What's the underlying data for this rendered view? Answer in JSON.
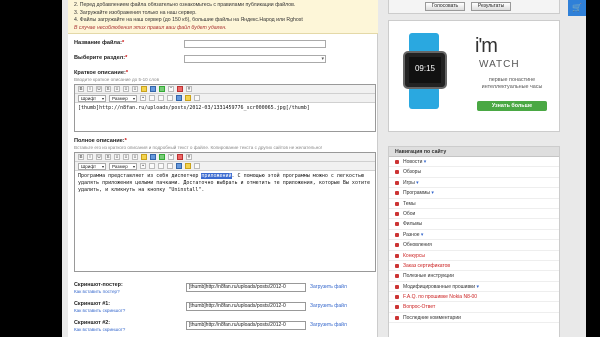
{
  "notice": {
    "line1": "2. Перед добавлением файла обязательно ознакомьтесь с правилами публикации файлов.",
    "line2": "3. Загружайте изображения только на наш сервер.",
    "line3": "4. Файлы загружайте на наш сервер (до 150 кб), большие файлы на Яндекс.Народ или Rghost",
    "line4": "В случае несоблюдения этих правил ваш файл будет удален."
  },
  "form": {
    "file_name_label": "Название файла:",
    "section_label": "Выберите раздел:",
    "short_desc_label": "Краткое описание:",
    "short_desc_hint": "Вводите краткое описание до 5-10 слов",
    "full_desc_label": "Полное описание:",
    "full_desc_hint": "Вставьте его из краткого описания и подробный текст о файле. Копирование текста с других сайтов не желательно!",
    "required_mark": "*"
  },
  "editor": {
    "font_label": "Шрифт",
    "size_label": "Размер",
    "short_text": "[thumb]http://n8fan.ru/uploads/posts/2012-03/1331459776_scr000065.jpg[/thumb]",
    "full_text_before": "Программа представляет из себя диспетчер ",
    "full_text_highlight": "приложений",
    "full_text_after": ". С помощью этой программы можно с легкостью удалять приложения целыми пачками. Достаточно выбрать и отметить те приложения, которые Вы хотите удалить, и кликнуть на кнопку \"Uninstall\"."
  },
  "uploads": [
    {
      "label": "Скриншот-постер:",
      "link": "Как вставить постер?",
      "value": "[thumb]http://n8fan.ru/uploads/posts/2012-0",
      "button": "Загрузить файл"
    },
    {
      "label": "Скриншот #1:",
      "link": "Как вставить скриншот?",
      "value": "[thumb]http://n8fan.ru/uploads/posts/2012-0",
      "button": "Загрузить файл"
    },
    {
      "label": "Скриншот #2:",
      "link": "Как вставить скриншот?",
      "value": "[thumb]http://n8fan.ru/uploads/posts/2012-0",
      "button": "Загрузить файл"
    }
  ],
  "sidebar": {
    "vote_button": "Голосовать",
    "results_button": "Результаты",
    "ad": {
      "brand": "i'm",
      "brand_sub": "WATCH",
      "screen_time": "09:15",
      "tagline": "первые понастине интеллектуальные часы",
      "cta": "Узнать больше"
    },
    "nav_title": "Навигация по сайту",
    "nav_items": [
      {
        "label": "Новости",
        "red": false,
        "caret": true
      },
      {
        "label": "Обзоры",
        "red": false,
        "caret": false
      },
      {
        "label": "Игры",
        "red": false,
        "caret": true
      },
      {
        "label": "Программы",
        "red": false,
        "caret": true
      },
      {
        "label": "Темы",
        "red": false,
        "caret": false
      },
      {
        "label": "Обои",
        "red": false,
        "caret": false
      },
      {
        "label": "Фильмы",
        "red": false,
        "caret": false
      },
      {
        "label": "Разное",
        "red": false,
        "caret": true
      },
      {
        "label": "Обновления",
        "red": false,
        "caret": false
      },
      {
        "label": "Конкурсы",
        "red": true,
        "caret": false
      },
      {
        "label": "Заказ сертификатов",
        "red": true,
        "caret": false
      },
      {
        "label": "Полезные инструкции",
        "red": false,
        "caret": false
      },
      {
        "label": "Модифицированные прошивки",
        "red": false,
        "caret": true
      },
      {
        "label": "F.A.Q. по прошивке Nokia N8-00",
        "red": true,
        "caret": false
      },
      {
        "label": "Вопрос-Ответ",
        "red": true,
        "caret": false
      },
      {
        "label": "Последние комментарии",
        "red": false,
        "caret": false
      }
    ]
  },
  "colors": {
    "accent": "#2f80d8",
    "notice_bg": "#fdf6d8",
    "selection": "#3a6ad0",
    "ad_button": "#4aa844",
    "watch_strap": "#2aa8e0"
  }
}
